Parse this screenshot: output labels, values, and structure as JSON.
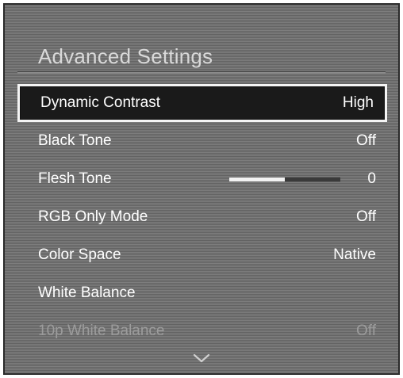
{
  "panel": {
    "title": "Advanced Settings"
  },
  "menu": {
    "items": [
      {
        "label": "Dynamic Contrast",
        "value": "High"
      },
      {
        "label": "Black Tone",
        "value": "Off"
      },
      {
        "label": "Flesh Tone",
        "value": "0",
        "slider_level_percent": 50
      },
      {
        "label": "RGB Only Mode",
        "value": "Off"
      },
      {
        "label": "Color Space",
        "value": "Native"
      },
      {
        "label": "White Balance",
        "value": ""
      },
      {
        "label": "10p White Balance",
        "value": "Off"
      }
    ]
  },
  "icons": {
    "scroll_down": "chevron-down-icon"
  },
  "colors": {
    "panel_bg": "#6e6e6e",
    "selection_border": "#f4f4f4",
    "text": "#ffffff",
    "disabled_text": "#9c9c9c"
  }
}
